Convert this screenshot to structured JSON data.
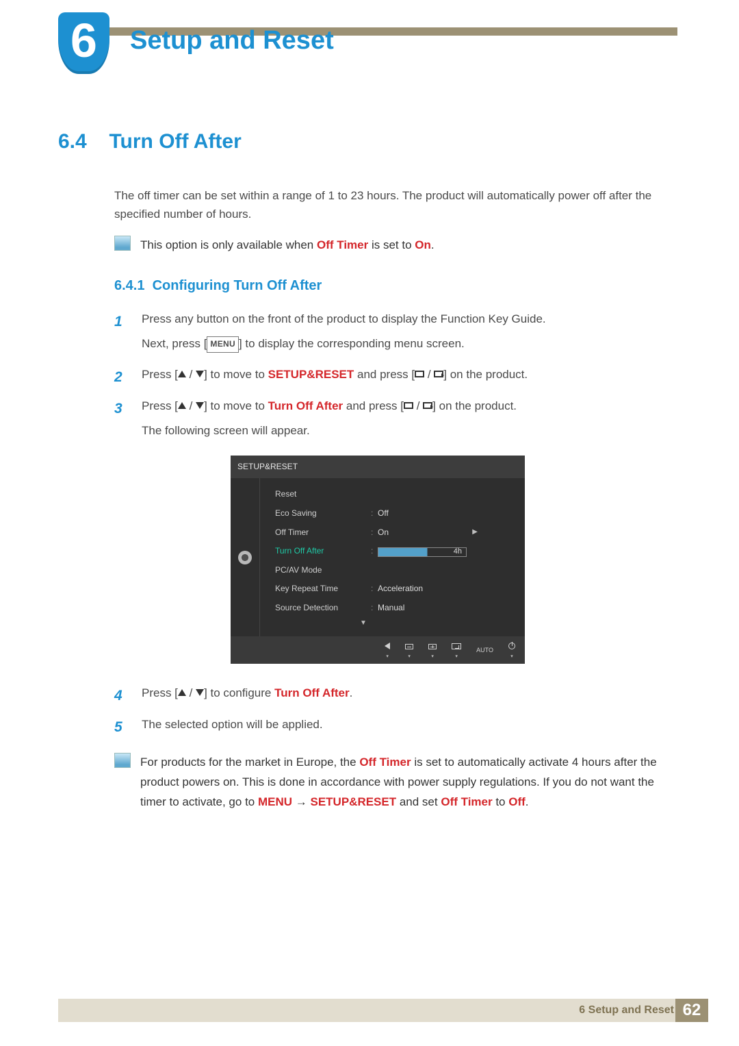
{
  "chapter": {
    "number": "6",
    "title": "Setup and Reset"
  },
  "section": {
    "number": "6.4",
    "title": "Turn Off After"
  },
  "intro": "The off timer can be set within a range of 1 to 23 hours. The product will automatically power off after the specified number of hours.",
  "note1": {
    "prefix": "This option is only available when ",
    "em1": "Off Timer",
    "mid": " is set to ",
    "em2": "On",
    "suffix": "."
  },
  "subsection": {
    "number": "6.4.1",
    "title": "Configuring Turn Off After"
  },
  "steps": {
    "1": {
      "p1": "Press any button on the front of the product to display the Function Key Guide.",
      "p2a": "Next, press [",
      "menu": "MENU",
      "p2b": "] to display the corresponding menu screen."
    },
    "2": {
      "a": "Press [",
      "b": "] to move to ",
      "target": "SETUP&RESET",
      "c": " and press [",
      "d": "] on the product."
    },
    "3": {
      "a": "Press [",
      "b": "] to move to ",
      "target": "Turn Off After",
      "c": " and press [",
      "d": "] on the product.",
      "e": "The following screen will appear."
    },
    "4": {
      "a": "Press [",
      "b": "] to configure ",
      "target": "Turn Off After",
      "suffix": "."
    },
    "5": {
      "text": "The selected option will be applied."
    }
  },
  "osd": {
    "title": "SETUP&RESET",
    "items": [
      {
        "label": "Reset",
        "value": ""
      },
      {
        "label": "Eco Saving",
        "value": "Off"
      },
      {
        "label": "Off Timer",
        "value": "On"
      },
      {
        "label": "Turn Off After",
        "value": "4h",
        "selected": true,
        "slider": true
      },
      {
        "label": "PC/AV Mode",
        "value": ""
      },
      {
        "label": "Key Repeat Time",
        "value": "Acceleration"
      },
      {
        "label": "Source Detection",
        "value": "Manual"
      }
    ],
    "auto": "AUTO"
  },
  "note2": {
    "a": "For products for the market in Europe, the ",
    "em1": "Off Timer",
    "b": " is set to automatically activate 4 hours after the product powers on. This is done in accordance with power supply regulations. If you do not want the timer to activate, go to ",
    "em2": "MENU",
    "arrow": "  →  ",
    "em3": "SETUP&RESET",
    "c": " and set ",
    "em4": "Off Timer",
    "d": " to ",
    "em5": "Off",
    "e": "."
  },
  "footer": {
    "text": "6 Setup and Reset",
    "page": "62"
  }
}
